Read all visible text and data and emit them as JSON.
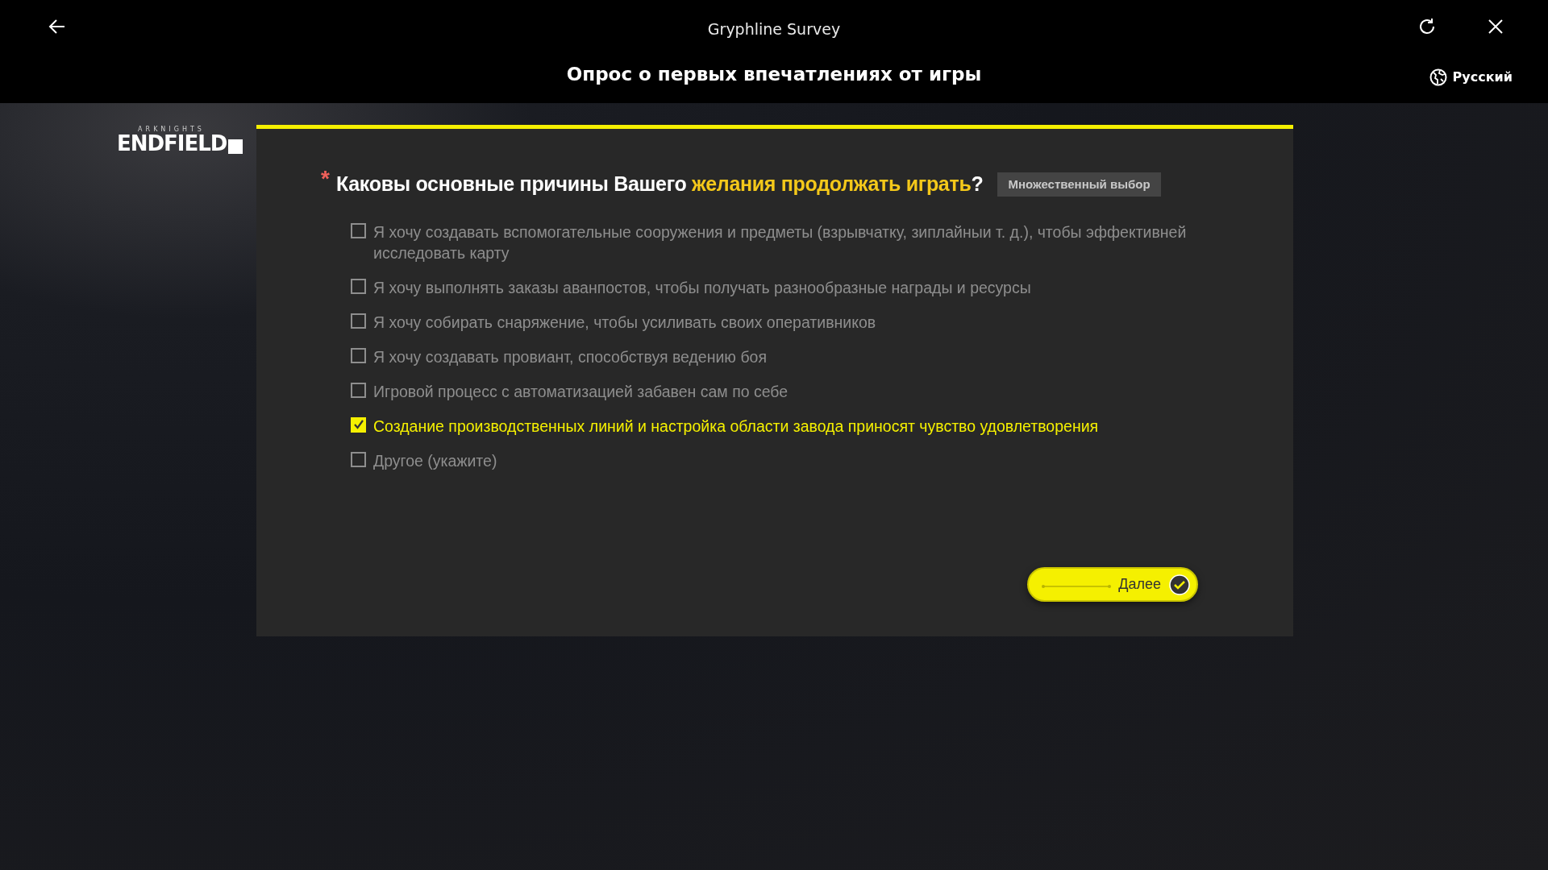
{
  "window": {
    "title": "Gryphline Survey"
  },
  "header": {
    "survey_title": "Опрос о первых впечатлениях от игры",
    "language": "Русский"
  },
  "logo": {
    "tagline": "ARKNIGHTS",
    "wordmark": "ENDFIELD"
  },
  "question": {
    "required": true,
    "required_mark": "*",
    "segments": [
      {
        "text": "Каковы основные причины Вашего ",
        "highlighted": false
      },
      {
        "text": "желания продолжать играть",
        "highlighted": true
      },
      {
        "text": "?",
        "highlighted": false
      }
    ],
    "type_badge": "Множественный выбор"
  },
  "options": [
    {
      "label": "Я хочу создавать вспомогательные сооружения и предметы (взрывчатку, зиплайныи т. д.), чтобы эффективней исследовать карту",
      "checked": false
    },
    {
      "label": "Я хочу выполнять заказы аванпостов, чтобы получать разнообразные награды и ресурсы",
      "checked": false
    },
    {
      "label": "Я хочу собирать снаряжение, чтобы усиливать своих оперативников",
      "checked": false
    },
    {
      "label": "Я хочу создавать провиант, способствуя ведению боя",
      "checked": false
    },
    {
      "label": "Игровой процесс с автоматизацией забавен сам по себе",
      "checked": false
    },
    {
      "label": "Создание производственных линий и настройка области завода приносят чувство удовлетворения",
      "checked": true
    },
    {
      "label": "Другое (укажите)",
      "checked": false
    }
  ],
  "next_button": {
    "label": "Далее"
  }
}
